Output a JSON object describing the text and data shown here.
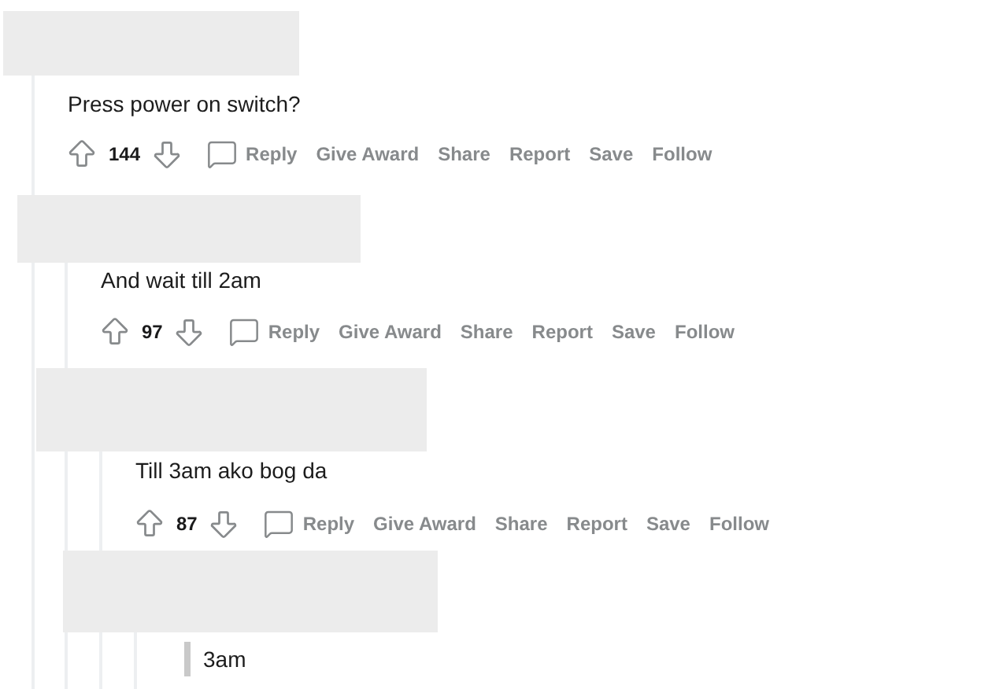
{
  "thread": {
    "comments": [
      {
        "kind": "plain",
        "text": "Press power on switch?",
        "score": "144",
        "actions": [
          "Reply",
          "Give Award",
          "Share",
          "Report",
          "Save",
          "Follow"
        ],
        "children": [
          {
            "kind": "plain",
            "text": "And wait till 2am",
            "score": "97",
            "actions": [
              "Reply",
              "Give Award",
              "Share",
              "Report",
              "Save",
              "Follow"
            ],
            "children": [
              {
                "kind": "plain",
                "text": "Till 3am ako bog da",
                "score": "87",
                "actions": [
                  "Reply",
                  "Give Award",
                  "Share",
                  "Report",
                  "Save",
                  "Follow"
                ],
                "children": [
                  {
                    "kind": "quote",
                    "text": "3am"
                  }
                ]
              }
            ]
          }
        ]
      }
    ]
  }
}
